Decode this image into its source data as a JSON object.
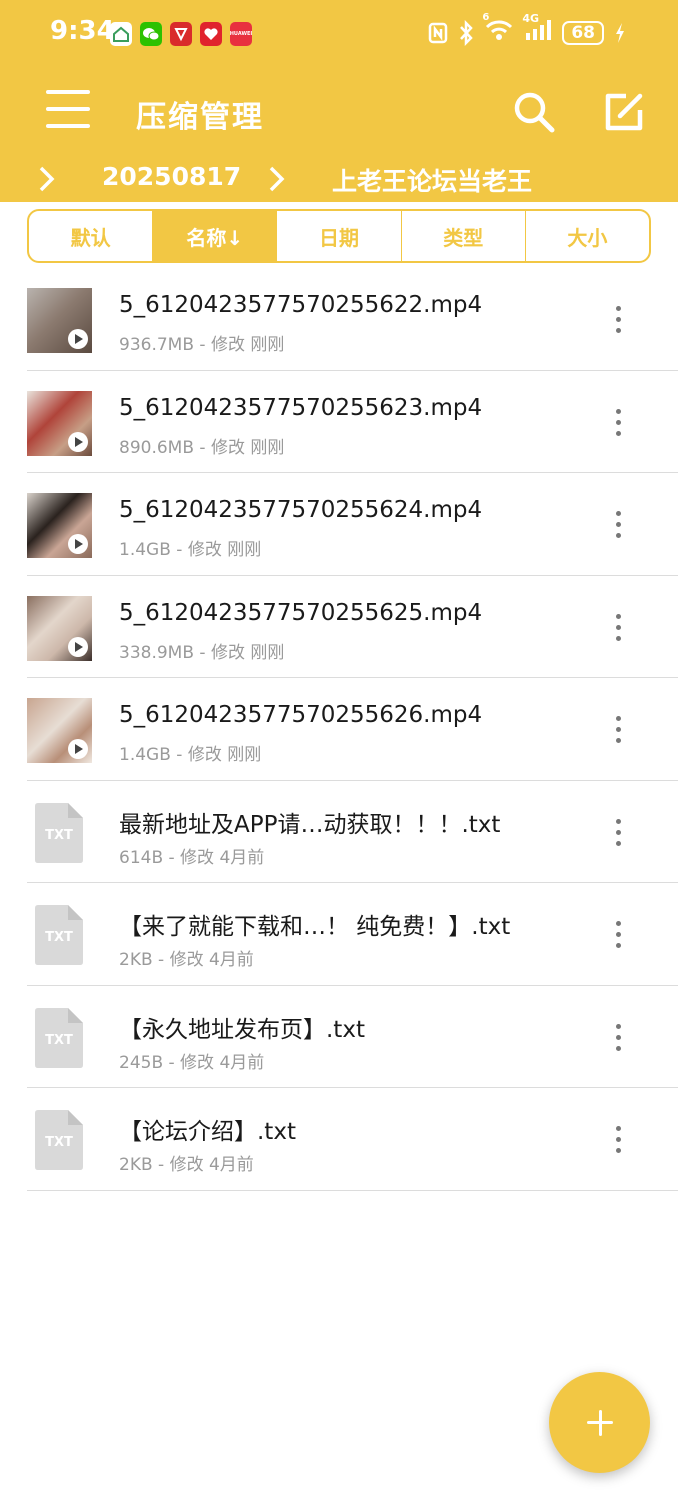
{
  "status_bar": {
    "time": "9:34",
    "battery": "68",
    "network": "4G",
    "wifi_badge": "6",
    "app_icons": [
      "home-app-icon",
      "wechat-icon",
      "app-red-icon",
      "app-heart-icon",
      "huawei-icon"
    ],
    "huawei_label": "HUAWEI"
  },
  "appbar": {
    "title": "压缩管理",
    "icons": [
      "menu-icon",
      "search-icon",
      "edit-icon"
    ]
  },
  "breadcrumb": [
    "20250817",
    "上老王论坛当老王"
  ],
  "sort_tabs": [
    {
      "label": "默认",
      "active": false
    },
    {
      "label": "名称↓",
      "active": true
    },
    {
      "label": "日期",
      "active": false
    },
    {
      "label": "类型",
      "active": false
    },
    {
      "label": "大小",
      "active": false
    }
  ],
  "files": [
    {
      "type": "video",
      "name": "5_6120423577570255622.mp4",
      "meta": "936.7MB - 修改 刚刚"
    },
    {
      "type": "video",
      "name": "5_6120423577570255623.mp4",
      "meta": "890.6MB - 修改 刚刚"
    },
    {
      "type": "video",
      "name": "5_6120423577570255624.mp4",
      "meta": "1.4GB - 修改 刚刚"
    },
    {
      "type": "video",
      "name": "5_6120423577570255625.mp4",
      "meta": "338.9MB - 修改 刚刚"
    },
    {
      "type": "video",
      "name": "5_6120423577570255626.mp4",
      "meta": "1.4GB - 修改 刚刚"
    },
    {
      "type": "txt",
      "name": "最新地址及APP请…动获取！！！.txt",
      "meta": "614B - 修改 4月前",
      "icon_label": "TXT"
    },
    {
      "type": "txt",
      "name": "【来了就能下载和…！ 纯免费！】.txt",
      "meta": "2KB - 修改 4月前",
      "icon_label": "TXT"
    },
    {
      "type": "txt",
      "name": "【永久地址发布页】.txt",
      "meta": "245B - 修改 4月前",
      "icon_label": "TXT"
    },
    {
      "type": "txt",
      "name": "【论坛介绍】.txt",
      "meta": "2KB - 修改 4月前",
      "icon_label": "TXT"
    }
  ],
  "colors": {
    "accent": "#F2C744",
    "divider": "#dcdcdc",
    "meta_text": "#9a9a9a",
    "txt_icon": "#d9d9d9"
  },
  "fab": {
    "icon": "plus-icon"
  }
}
